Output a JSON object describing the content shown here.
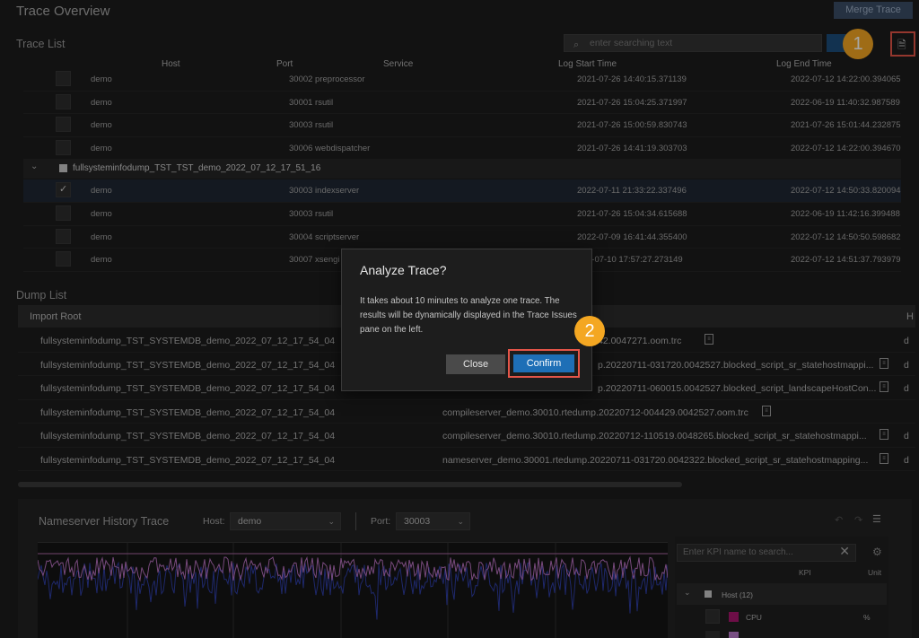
{
  "app": {
    "title": "Trace Overview",
    "merge_label": "Merge Trace"
  },
  "trace_list": {
    "title": "Trace List",
    "search_placeholder": "enter searching text",
    "columns": [
      "Host",
      "Port",
      "Service",
      "Log Start Time",
      "Log End Time"
    ],
    "rows_top": [
      {
        "host": "demo",
        "port_service": "30002 preprocessor",
        "start": "2021-07-26 14:40:15.371139",
        "end": "2022-07-12 14:22:00.394065"
      },
      {
        "host": "demo",
        "port_service": "30001 rsutil",
        "start": "2021-07-26 15:04:25.371997",
        "end": "2022-06-19 11:40:32.987589"
      },
      {
        "host": "demo",
        "port_service": "30003 rsutil",
        "start": "2021-07-26 15:00:59.830743",
        "end": "2021-07-26 15:01:44.232875"
      },
      {
        "host": "demo",
        "port_service": "30006 webdispatcher",
        "start": "2021-07-26 14:41:19.303703",
        "end": "2022-07-12 14:22:00.394670"
      }
    ],
    "group_label": "fullsysteminfodump_TST_TST_demo_2022_07_12_17_51_16",
    "rows_group": [
      {
        "host": "demo",
        "port_service": "30003 indexserver",
        "start": "2022-07-11 21:33:22.337496",
        "end": "2022-07-12 14:50:33.820094"
      },
      {
        "host": "demo",
        "port_service": "30003 rsutil",
        "start": "2021-07-26 15:04:34.615688",
        "end": "2022-06-19 11:42:16.399488"
      },
      {
        "host": "demo",
        "port_service": "30004 scriptserver",
        "start": "2022-07-09 16:41:44.355400",
        "end": "2022-07-12 14:50:50.598682"
      },
      {
        "host": "demo",
        "port_service": "30007 xsengi",
        "start": "2-07-10 17:57:27.273149",
        "end": "2022-07-12 14:51:37.793979"
      }
    ]
  },
  "dump_list": {
    "title": "Dump List",
    "col_import_root": "Import Root",
    "col_last": "H",
    "rows": [
      {
        "root": "fullsysteminfodump_TST_SYSTEMDB_demo_2022_07_12_17_54_04",
        "file": "42.0047271.oom.trc",
        "tail": "d"
      },
      {
        "root": "fullsysteminfodump_TST_SYSTEMDB_demo_2022_07_12_17_54_04",
        "file": "p.20220711-031720.0042527.blocked_script_sr_statehostmappi...",
        "tail": "d"
      },
      {
        "root": "fullsysteminfodump_TST_SYSTEMDB_demo_2022_07_12_17_54_04",
        "file": "p.20220711-060015.0042527.blocked_script_landscapeHostCon...",
        "tail": "d"
      },
      {
        "root": "fullsysteminfodump_TST_SYSTEMDB_demo_2022_07_12_17_54_04",
        "file": "compileserver_demo.30010.rtedump.20220712-004429.0042527.oom.trc",
        "tail": ""
      },
      {
        "root": "fullsysteminfodump_TST_SYSTEMDB_demo_2022_07_12_17_54_04",
        "file": "compileserver_demo.30010.rtedump.20220712-110519.0048265.blocked_script_sr_statehostmappi...",
        "tail": "d"
      },
      {
        "root": "fullsysteminfodump_TST_SYSTEMDB_demo_2022_07_12_17_54_04",
        "file": "nameserver_demo.30001.rtedump.20220711-031720.0042322.blocked_script_sr_statehostmapping...",
        "tail": "d"
      }
    ]
  },
  "history": {
    "title": "Nameserver History Trace",
    "host_label": "Host:",
    "host_value": "demo",
    "port_label": "Port:",
    "port_value": "30003",
    "kpi_placeholder": "Enter KPI name to search...",
    "kpi_col": "KPI",
    "unit_col": "Unit",
    "kpi_group": "Host (12)",
    "kpi_rows": [
      {
        "name": "CPU",
        "unit": "%"
      }
    ]
  },
  "dialog": {
    "title": "Analyze Trace?",
    "body": "It takes about 10 minutes to analyze one trace. The results will be dynamically displayed in the Trace Issues pane on the left.",
    "close_label": "Close",
    "confirm_label": "Confirm"
  },
  "callouts": {
    "one": "1",
    "two": "2"
  }
}
